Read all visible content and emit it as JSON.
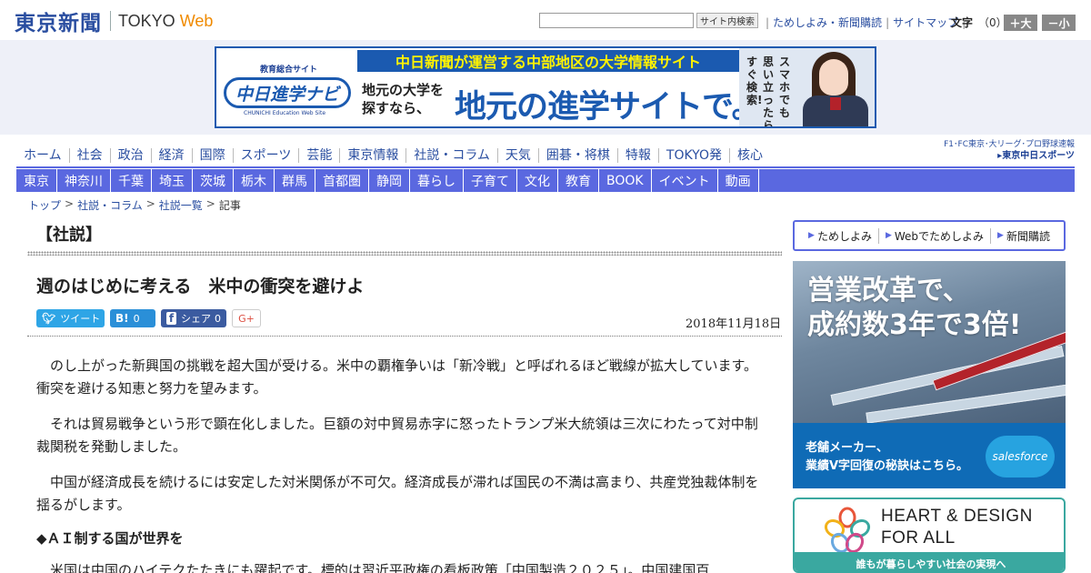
{
  "header": {
    "logo_jp": "東京新聞",
    "logo_en": "TOKYO",
    "logo_web": "Web",
    "search_button": "サイト内検索",
    "top_links": [
      "ためしよみ・新聞購読",
      "サイトマップ"
    ],
    "font_label": "文字",
    "font_value": "（0）",
    "font_larger": "＋大",
    "font_smaller": "－小"
  },
  "ad_banner": {
    "top_line": "中日新聞が運営する中部地区の大学情報サイト",
    "logo_small": "教育総合サイト",
    "logo_main": "中日進学ナビ",
    "logo_en": "CHUNICHI Education Web Site",
    "sub_line": "地元の大学を探すなら、",
    "main_line": "地元の進学サイトで。",
    "vertical_col1": "スマホでも",
    "vertical_col2": "思い立ったら",
    "vertical_col3": "すぐ検索!"
  },
  "nav_primary": [
    "ホーム",
    "社会",
    "政治",
    "経済",
    "国際",
    "スポーツ",
    "芸能",
    "東京情報",
    "社説・コラム",
    "天気",
    "囲碁・将棋",
    "特報",
    "TOKYO発",
    "核心"
  ],
  "chunichi_sports": {
    "line1": "F1･FC東京･大リーグ･プロ野球速報",
    "line2": "▸東京中日スポーツ"
  },
  "nav_secondary": [
    "東京",
    "神奈川",
    "千葉",
    "埼玉",
    "茨城",
    "栃木",
    "群馬",
    "首都圏",
    "静岡",
    "暮らし",
    "子育て",
    "文化",
    "教育",
    "BOOK",
    "イベント",
    "動画"
  ],
  "breadcrumb": [
    "トップ",
    "社説・コラム",
    "社説一覧",
    "記事"
  ],
  "article": {
    "section": "【社説】",
    "title": "週のはじめに考える　米中の衝突を避けよ",
    "date": "2018年11月18日",
    "share": {
      "twitter": "ツイート",
      "hatena_count": "0",
      "facebook": "シェア",
      "facebook_count": "0",
      "gplus": "G+"
    },
    "paragraphs": [
      "のし上がった新興国の挑戦を超大国が受ける。米中の覇権争いは「新冷戦」と呼ばれるほど戦線が拡大しています。衝突を避ける知恵と努力を望みます。",
      "それは貿易戦争という形で顕在化しました。巨額の対中貿易赤字に怒ったトランプ米大統領は三次にわたって対中制裁関税を発動しました。",
      "中国が経済成長を続けるには安定した対米関係が不可欠。経済成長が滞れば国民の不満は高まり、共産党独裁体制を揺るがします。"
    ],
    "subheading": "◆ＡＩ制する国が世界を",
    "paragraph4": "米国は中国のハイテクたたきにも躍起です。標的は習近平政権の看板政策「中国製造２０２５」。中国建国百"
  },
  "sidebar": {
    "links": [
      "ためしよみ",
      "Webでためしよみ",
      "新聞購読"
    ],
    "ad_sales": {
      "headline1": "営業改革で、",
      "headline2": "成約数3年で3倍!",
      "line1": "老舗メーカー、",
      "line2": "業績V字回復の秘訣はこちら。",
      "brand": "salesforce"
    },
    "ad_heart": {
      "line1": "HEART & DESIGN",
      "line2": "FOR ALL",
      "strip": "誰もが暮らしやすい社会の実現へ"
    }
  },
  "colors": {
    "brand_blue": "#2a4ea0",
    "nav_purple": "#5a68e0",
    "accent_orange": "#f08a00"
  }
}
